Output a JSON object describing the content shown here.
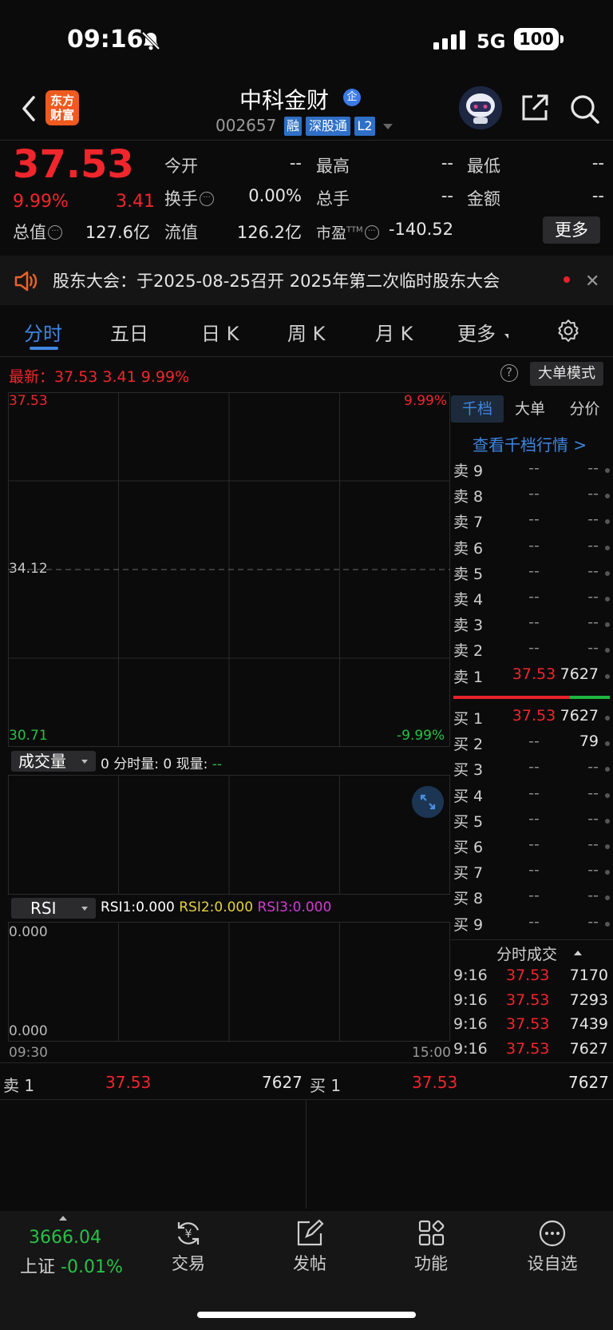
{
  "status": {
    "time": "09:16",
    "network": "5G",
    "battery": "100"
  },
  "header": {
    "stock_name": "中科金财",
    "name_badge": "企",
    "code": "002657",
    "tags": [
      "融",
      "深股通",
      "L2"
    ],
    "logo_text": "东方财富"
  },
  "quote": {
    "price": "37.53",
    "pct_change": "9.99%",
    "change": "3.41",
    "fields": {
      "open_label": "今开",
      "open": "--",
      "high_label": "最高",
      "high": "--",
      "low_label": "最低",
      "low": "--",
      "turnover_label": "换手",
      "turnover": "0.00%",
      "volume_label": "总手",
      "volume": "--",
      "amount_label": "金额",
      "amount": "--",
      "mktcap_label": "总值",
      "mktcap": "127.6亿",
      "float_label": "流值",
      "float": "126.2亿",
      "pe_label": "市盈",
      "pe_sup": "TTM",
      "pe": "-140.52"
    },
    "more_label": "更多"
  },
  "notice": {
    "text": "股东大会：于2025-08-25召开 2025年第二次临时股东大会"
  },
  "tabs": [
    "分时",
    "五日",
    "日 K",
    "周 K",
    "月 K",
    "更多"
  ],
  "chart": {
    "latest": "最新：37.53  3.41  9.99%",
    "help": "?",
    "big_mode": "大单模式",
    "top_price": "37.53",
    "mid_price": "34.12",
    "bottom_price": "30.71",
    "top_pct": "9.99%",
    "bottom_pct": "-9.99%",
    "vol_select": "成交量",
    "vol_info_prefix": "0 分时量: 0 现量: ",
    "vol_info_now": "--",
    "rsi_select": "RSI",
    "rsi1": "RSI1:0.000",
    "rsi2": "RSI2:0.000",
    "rsi3": "RSI3:0.000",
    "rsi_top": "0.000",
    "rsi_bottom": "0.000",
    "time_start": "09:30",
    "time_end": "15:00",
    "colors": {
      "rsi1": "#ffffff",
      "rsi2": "#e6d13a",
      "rsi3": "#d33bd3"
    }
  },
  "orderbook": {
    "tabs": [
      "千档",
      "大单",
      "分价"
    ],
    "view_depth": "查看千档行情 >",
    "asks": [
      {
        "label": "卖 9",
        "price": "--",
        "vol": "--"
      },
      {
        "label": "卖 8",
        "price": "--",
        "vol": "--"
      },
      {
        "label": "卖 7",
        "price": "--",
        "vol": "--"
      },
      {
        "label": "卖 6",
        "price": "--",
        "vol": "--"
      },
      {
        "label": "卖 5",
        "price": "--",
        "vol": "--"
      },
      {
        "label": "卖 4",
        "price": "--",
        "vol": "--"
      },
      {
        "label": "卖 3",
        "price": "--",
        "vol": "--"
      },
      {
        "label": "卖 2",
        "price": "--",
        "vol": "--"
      },
      {
        "label": "卖 1",
        "price": "37.53",
        "vol": "7627"
      }
    ],
    "bids": [
      {
        "label": "买 1",
        "price": "37.53",
        "vol": "7627"
      },
      {
        "label": "买 2",
        "price": "--",
        "vol": "79"
      },
      {
        "label": "买 3",
        "price": "--",
        "vol": "--"
      },
      {
        "label": "买 4",
        "price": "--",
        "vol": "--"
      },
      {
        "label": "买 5",
        "price": "--",
        "vol": "--"
      },
      {
        "label": "买 6",
        "price": "--",
        "vol": "--"
      },
      {
        "label": "买 7",
        "price": "--",
        "vol": "--"
      },
      {
        "label": "买 8",
        "price": "--",
        "vol": "--"
      },
      {
        "label": "买 9",
        "price": "--",
        "vol": "--"
      }
    ],
    "trades_head": "分时成交",
    "trades": [
      {
        "time": "9:16",
        "price": "37.53",
        "vol": "7170"
      },
      {
        "time": "9:16",
        "price": "37.53",
        "vol": "7293"
      },
      {
        "time": "9:16",
        "price": "37.53",
        "vol": "7439"
      },
      {
        "time": "9:16",
        "price": "37.53",
        "vol": "7627"
      }
    ]
  },
  "strip": {
    "ask_label": "卖 1",
    "ask_price": "37.53",
    "ask_vol": "7627",
    "bid_label": "买 1",
    "bid_price": "37.53",
    "bid_vol": "7627"
  },
  "bottom_nav": {
    "index_value": "3666.04",
    "index_name": "上证",
    "index_change": "-0.01%",
    "items": [
      "交易",
      "发帖",
      "功能",
      "设自选"
    ]
  }
}
